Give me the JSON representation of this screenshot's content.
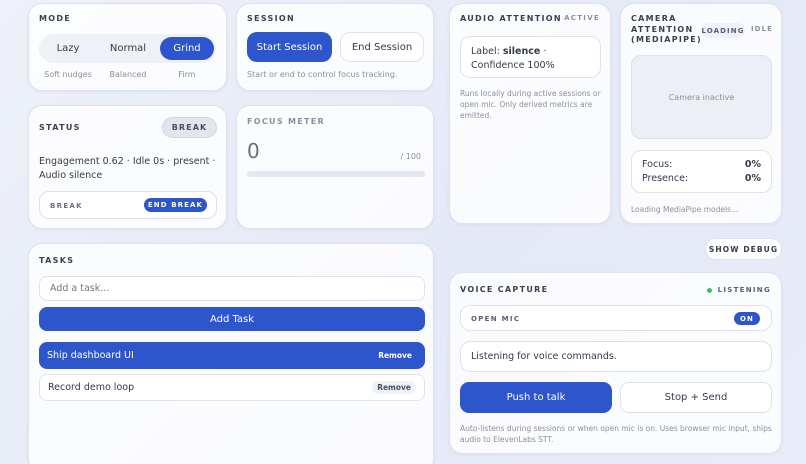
{
  "mode": {
    "title": "MODE",
    "options": [
      "Lazy",
      "Normal",
      "Grind"
    ],
    "descriptions": [
      "Soft nudges",
      "Balanced",
      "Firm"
    ],
    "selected": "Grind"
  },
  "session": {
    "title": "SESSION",
    "start_label": "Start Session",
    "end_label": "End Session",
    "hint": "Start or end to control focus tracking."
  },
  "audio": {
    "title": "AUDIO ATTENTION",
    "status": "ACTIVE",
    "label_prefix": "Label: ",
    "label_value": "silence",
    "confidence": " · Confidence 100%",
    "description": "Runs locally during active sessions or open mic. Only derived metrics are emitted."
  },
  "camera": {
    "title": "CAMERA ATTENTION (MEDIAPIPE)",
    "loading_badge": "LOADING",
    "idle_badge": "IDLE",
    "preview_text": "Camera inactive",
    "focus_label": "Focus:",
    "focus_value": "0%",
    "presence_label": "Presence:",
    "presence_value": "0%",
    "footer": "Loading MediaPipe models..."
  },
  "status": {
    "title": "STATUS",
    "badge": "BREAK",
    "summary": "Engagement 0.62 · Idle 0s · present · Audio silence",
    "break_label": "BREAK",
    "end_break_label": "END BREAK"
  },
  "focus_meter": {
    "title": "FOCUS METER",
    "value": "0",
    "max": "/ 100",
    "fill_fraction": 0
  },
  "debug": {
    "label": "SHOW DEBUG"
  },
  "tasks": {
    "title": "TASKS",
    "placeholder": "Add a task...",
    "add_label": "Add Task",
    "items": [
      {
        "name": "Ship dashboard UI",
        "remove": "Remove",
        "active": true
      },
      {
        "name": "Record demo loop",
        "remove": "Remove",
        "active": false
      }
    ]
  },
  "voice": {
    "title": "VOICE CAPTURE",
    "status": "LISTENING",
    "open_mic_label": "OPEN MIC",
    "open_mic_toggle": "ON",
    "transcript": "Listening for voice commands.",
    "push_label": "Push to talk",
    "stop_label": "Stop + Send",
    "description": "Auto-listens during sessions or when open mic is on. Uses browser mic input, ships audio to ElevenLabs STT."
  },
  "colors": {
    "accent": "#2d55cc",
    "listening_dot": "#3cbf6a"
  }
}
